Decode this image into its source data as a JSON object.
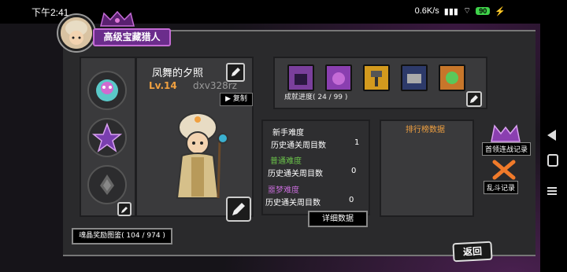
{
  "status": {
    "time": "下午2:41",
    "speed": "0.6K/s",
    "battery": "90"
  },
  "header": {
    "title": "高级宝藏猎人"
  },
  "character": {
    "name": "凤舞的夕照",
    "level": "Lv.14",
    "id": "dxv328rz",
    "copy_label": "复制"
  },
  "achievements": {
    "progress": "成就进度( 24 / 99 )",
    "icons": [
      {
        "name": "castle-icon",
        "color": "#7a3f9c"
      },
      {
        "name": "demon-icon",
        "color": "#8a3fb0"
      },
      {
        "name": "hammer-icon",
        "color": "#d39a1e"
      },
      {
        "name": "chest-icon",
        "color": "#2d3a6a"
      },
      {
        "name": "dragon-icon",
        "color": "#c7762a"
      }
    ]
  },
  "difficulty": {
    "novice_label": "新手难度",
    "novice_row_label": "历史通关周目数",
    "novice_count": "1",
    "normal_label": "普通难度",
    "normal_row_label": "历史通关周目数",
    "normal_count": "0",
    "nightmare_label": "噩梦难度",
    "nightmare_row_label": "历史通关周目数",
    "nightmare_count": "0"
  },
  "ranking": {
    "title": "排行榜数据"
  },
  "buttons": {
    "detail": "详细数据",
    "crystal": "魂晶奖励图鉴( 104 / 974 )",
    "boss_record": "首领连战记录",
    "brawl_record": "乱斗记录",
    "back": "返回"
  },
  "colors": {
    "accent": "#f0a040",
    "purple": "#6b2d8c",
    "normal_green": "#6ac24a",
    "nightmare_purple": "#c46bd6"
  }
}
